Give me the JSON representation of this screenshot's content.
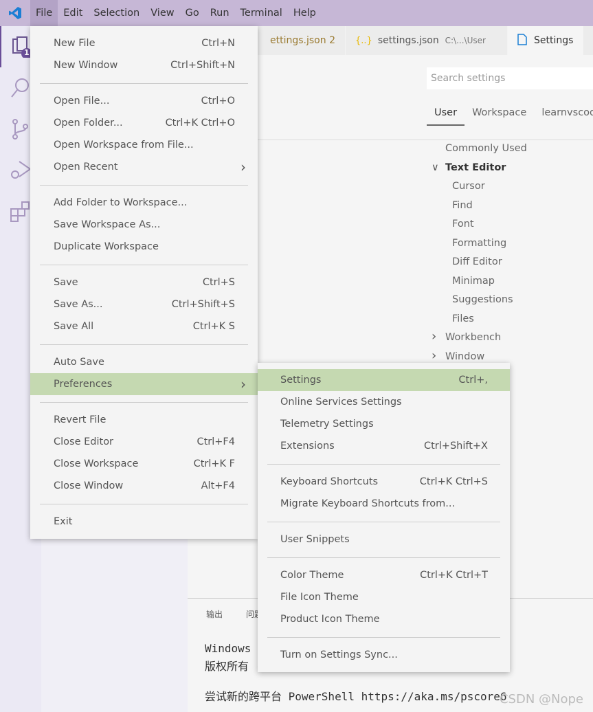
{
  "menubar": {
    "items": [
      "File",
      "Edit",
      "Selection",
      "View",
      "Go",
      "Run",
      "Terminal",
      "Help"
    ]
  },
  "activity": {
    "explorer_badge": "1"
  },
  "tabs": [
    {
      "label": "ettings.json",
      "badge": "2"
    },
    {
      "label": "settings.json",
      "detail": "C:\\...\\User"
    },
    {
      "label": "Settings"
    }
  ],
  "settings": {
    "search_placeholder": "Search settings",
    "scope_tabs": [
      "User",
      "Workspace",
      "learnvscode"
    ],
    "tree": [
      {
        "label": "Commonly Used",
        "level": 0
      },
      {
        "label": "Text Editor",
        "level": 0,
        "expanded": true
      },
      {
        "label": "Cursor",
        "level": 1
      },
      {
        "label": "Find",
        "level": 1
      },
      {
        "label": "Font",
        "level": 1
      },
      {
        "label": "Formatting",
        "level": 1
      },
      {
        "label": "Diff Editor",
        "level": 1
      },
      {
        "label": "Minimap",
        "level": 1
      },
      {
        "label": "Suggestions",
        "level": 1
      },
      {
        "label": "Files",
        "level": 1
      },
      {
        "label": "Workbench",
        "level": 0,
        "collapsed": true
      },
      {
        "label": "Window",
        "level": 0,
        "collapsed": true
      }
    ]
  },
  "panel": {
    "tabs": [
      "输出",
      "问题"
    ],
    "lines": [
      "Windows",
      "版权所有 (C)                         保留所有权利。",
      "尝试新的跨平台 PowerShell https://aka.ms/pscore6"
    ]
  },
  "file_menu": [
    [
      {
        "label": "New File",
        "key": "Ctrl+N"
      },
      {
        "label": "New Window",
        "key": "Ctrl+Shift+N"
      }
    ],
    [
      {
        "label": "Open File...",
        "key": "Ctrl+O"
      },
      {
        "label": "Open Folder...",
        "key": "Ctrl+K Ctrl+O"
      },
      {
        "label": "Open Workspace from File...",
        "key": ""
      },
      {
        "label": "Open Recent",
        "key": "",
        "submenu": true
      }
    ],
    [
      {
        "label": "Add Folder to Workspace...",
        "key": ""
      },
      {
        "label": "Save Workspace As...",
        "key": ""
      },
      {
        "label": "Duplicate Workspace",
        "key": ""
      }
    ],
    [
      {
        "label": "Save",
        "key": "Ctrl+S"
      },
      {
        "label": "Save As...",
        "key": "Ctrl+Shift+S"
      },
      {
        "label": "Save All",
        "key": "Ctrl+K S"
      }
    ],
    [
      {
        "label": "Auto Save",
        "key": ""
      },
      {
        "label": "Preferences",
        "key": "",
        "submenu": true,
        "highlighted": true
      }
    ],
    [
      {
        "label": "Revert File",
        "key": ""
      },
      {
        "label": "Close Editor",
        "key": "Ctrl+F4"
      },
      {
        "label": "Close Workspace",
        "key": "Ctrl+K F"
      },
      {
        "label": "Close Window",
        "key": "Alt+F4"
      }
    ],
    [
      {
        "label": "Exit",
        "key": ""
      }
    ]
  ],
  "preferences_menu": [
    [
      {
        "label": "Settings",
        "key": "Ctrl+,",
        "highlighted": true
      },
      {
        "label": "Online Services Settings",
        "key": ""
      },
      {
        "label": "Telemetry Settings",
        "key": ""
      },
      {
        "label": "Extensions",
        "key": "Ctrl+Shift+X"
      }
    ],
    [
      {
        "label": "Keyboard Shortcuts",
        "key": "Ctrl+K Ctrl+S"
      },
      {
        "label": "Migrate Keyboard Shortcuts from...",
        "key": ""
      }
    ],
    [
      {
        "label": "User Snippets",
        "key": ""
      }
    ],
    [
      {
        "label": "Color Theme",
        "key": "Ctrl+K Ctrl+T"
      },
      {
        "label": "File Icon Theme",
        "key": ""
      },
      {
        "label": "Product Icon Theme",
        "key": ""
      }
    ],
    [
      {
        "label": "Turn on Settings Sync...",
        "key": ""
      }
    ]
  ],
  "watermark": "CSDN @Nope ",
  "colors": {
    "titlebar": "#c6b7d6",
    "highlight": "#c5d9b1",
    "accent": "#1a7ed4"
  }
}
